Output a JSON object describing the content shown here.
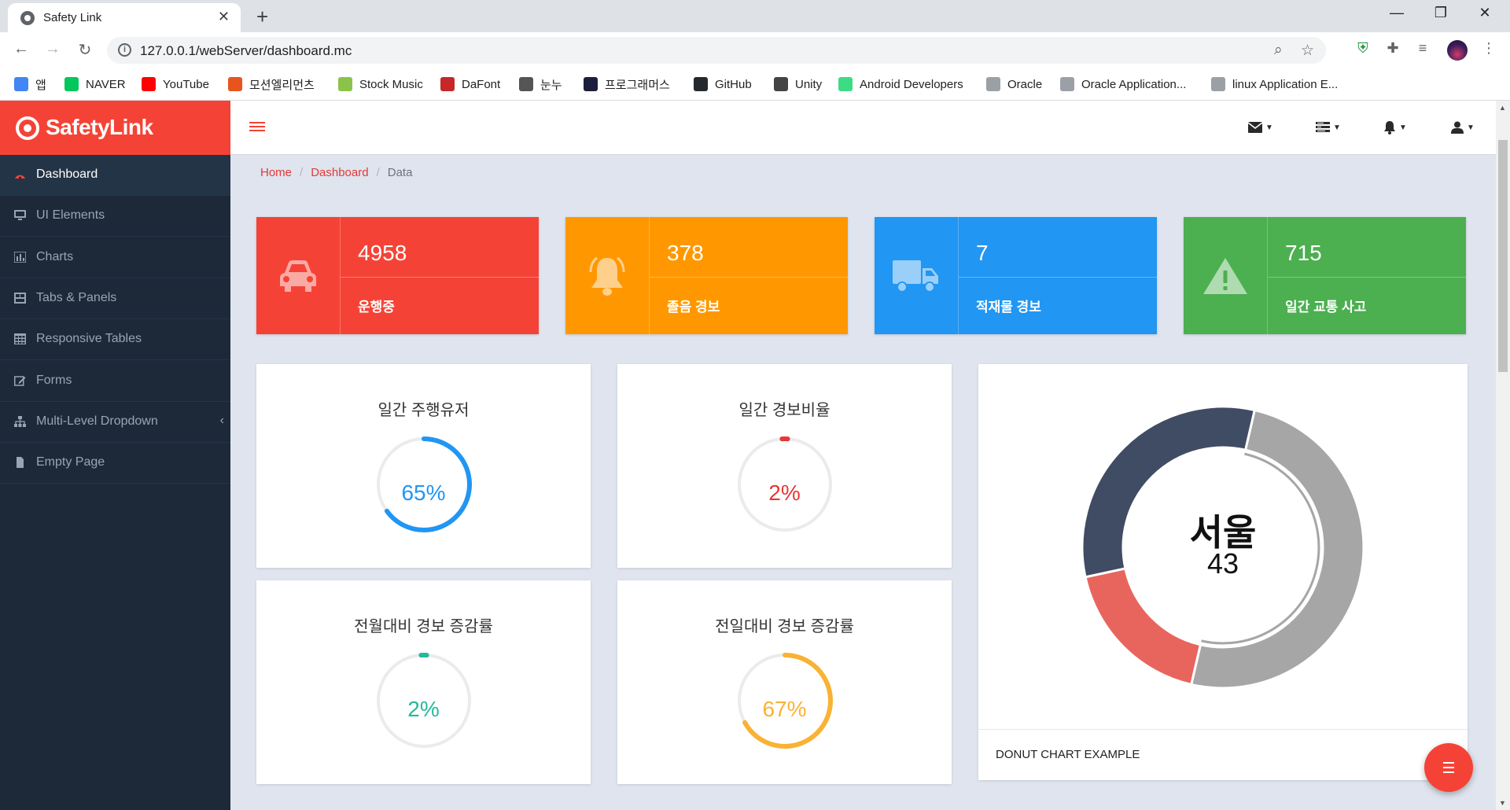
{
  "browser": {
    "tab_title": "Safety Link",
    "url": "127.0.0.1/webServer/dashboard.mc",
    "bookmarks": [
      {
        "label": "앱",
        "color": "#4285f4"
      },
      {
        "label": "NAVER",
        "color": "#03c75a"
      },
      {
        "label": "YouTube",
        "color": "#ff0000"
      },
      {
        "label": "모션엘리먼츠",
        "color": "#e8541e"
      },
      {
        "label": "Stock Music",
        "color": "#8bc34a"
      },
      {
        "label": "DaFont",
        "color": "#c62828"
      },
      {
        "label": "눈누",
        "color": "#555555"
      },
      {
        "label": "프로그래머스",
        "color": "#1b1f3b"
      },
      {
        "label": "GitHub",
        "color": "#24292e"
      },
      {
        "label": "Unity",
        "color": "#444444"
      },
      {
        "label": "Android Developers",
        "color": "#3ddc84"
      },
      {
        "label": "Oracle",
        "color": "#9aa0a6"
      },
      {
        "label": "Oracle Application...",
        "color": "#9aa0a6"
      },
      {
        "label": "linux Application E...",
        "color": "#9aa0a6"
      }
    ]
  },
  "app": {
    "brand": "SafetyLink",
    "accent": "#f44336",
    "sidebar": [
      {
        "label": "Dashboard",
        "icon": "dashboard-icon",
        "active": true
      },
      {
        "label": "UI Elements",
        "icon": "desktop-icon"
      },
      {
        "label": "Charts",
        "icon": "bar-chart-icon"
      },
      {
        "label": "Tabs & Panels",
        "icon": "panels-icon"
      },
      {
        "label": "Responsive Tables",
        "icon": "table-icon"
      },
      {
        "label": "Forms",
        "icon": "edit-icon"
      },
      {
        "label": "Multi-Level Dropdown",
        "icon": "sitemap-icon",
        "has_chevron": true
      },
      {
        "label": "Empty Page",
        "icon": "file-icon"
      }
    ],
    "breadcrumb": {
      "home": "Home",
      "section": "Dashboard",
      "current": "Data"
    },
    "stats": [
      {
        "value": "4958",
        "label": "운행중",
        "icon": "car-icon",
        "color": "#f44336"
      },
      {
        "value": "378",
        "label": "졸음 경보",
        "icon": "bell-icon",
        "color": "#ff9800"
      },
      {
        "value": "7",
        "label": "적재물 경보",
        "icon": "truck-icon",
        "color": "#2196f3"
      },
      {
        "value": "715",
        "label": "일간 교통 사고",
        "icon": "warning-icon",
        "color": "#4caf50"
      }
    ],
    "gauges": [
      {
        "title": "일간 주행유저",
        "value": "65%",
        "percent": 65,
        "color": "#2196f3"
      },
      {
        "title": "일간 경보비율",
        "value": "2%",
        "percent": 2,
        "color": "#e53935"
      },
      {
        "title": "전월대비 경보 증감률",
        "value": "2%",
        "percent": 2,
        "color": "#26b99a"
      },
      {
        "title": "전일대비 경보 증감률",
        "value": "67%",
        "percent": 67,
        "color": "#f9b233"
      }
    ],
    "donut": {
      "center_title": "서울",
      "center_value": "43",
      "footer": "DONUT CHART EXAMPLE"
    }
  },
  "chart_data": {
    "type": "pie",
    "title": "DONUT CHART EXAMPLE",
    "series": [
      {
        "values": [
          50,
          18,
          32
        ],
        "colors": [
          "#a6a6a6",
          "#e8655e",
          "#404c63"
        ]
      }
    ]
  }
}
